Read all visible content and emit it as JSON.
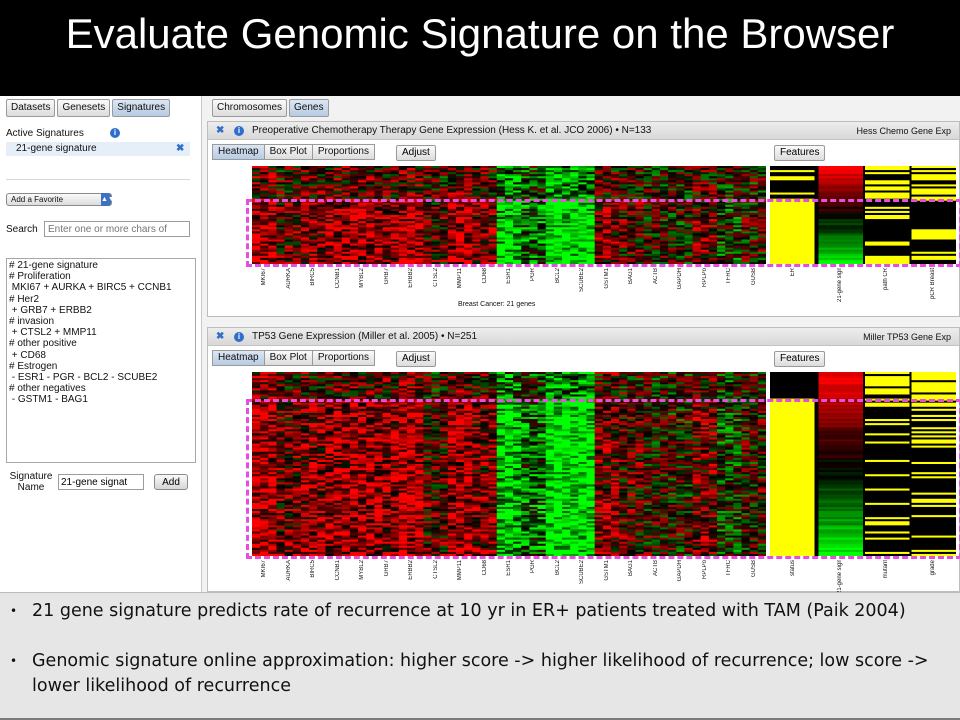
{
  "slide": {
    "title": "Evaluate Genomic Signature on the Browser"
  },
  "left_panel": {
    "tabs": [
      "Datasets",
      "Genesets",
      "Signatures"
    ],
    "active_tab": "Signatures",
    "active_signatures_label": "Active Signatures",
    "active_signature": "21-gene signature",
    "favorite_select_value": "Add a Favorite",
    "search_label": "Search",
    "search_placeholder": "Enter one or more chars of",
    "signature_text": "# 21-gene signature\n# Proliferation\n MKI67 + AURKA + BIRC5 + CCNB1\n# Her2\n + GRB7 + ERBB2\n# invasion\n + CTSL2 + MMP11\n# other positive\n + CD68\n# Estrogen\n - ESR1 - PGR - BCL2 - SCUBE2\n# other negatives\n - GSTM1 - BAG1",
    "signature_name_label": "Signature Name",
    "signature_name_value": "21-gene signat",
    "add_label": "Add"
  },
  "right_tabs": [
    "Chromosomes",
    "Genes"
  ],
  "right_active_tab": "Genes",
  "view_tabs": [
    "Heatmap",
    "Box Plot",
    "Proportions"
  ],
  "adjust_label": "Adjust",
  "features_label": "Features",
  "genes": [
    "MKI67",
    "AURKA",
    "BIRC5",
    "CCNB1",
    "MYBL2",
    "GRB7",
    "ERBB2",
    "CTSL2",
    "MMP11",
    "CD68",
    "ESR1",
    "PGR",
    "BCL2",
    "SCUBE2",
    "GSTM1",
    "BAG1",
    "ACTB",
    "GAPDH",
    "RPLPo",
    "TFRC",
    "GUSB"
  ],
  "panels": [
    {
      "title": "Preoperative Chemotherapy Therapy Gene Expression (Hess K. et al. JCO 2006) • N=133",
      "source": "Hess Chemo Gene Exp",
      "gene_caption": "Breast Cancer: 21 genes",
      "features": [
        "ER",
        "21-gene signature",
        "path CR",
        "pCR Breast"
      ]
    },
    {
      "title": "TP53 Gene Expression (Miller et al. 2005) • N=251",
      "source": "Miller TP53 Gene Exp",
      "features": [
        "status",
        "21-gene signature",
        "mutant",
        "grade"
      ]
    }
  ],
  "colors": {
    "heat_high": "#ff2a1a",
    "heat_low": "#33ff33",
    "feature_yellow": "#ffff00",
    "highlight_dash": "#e64ee0"
  },
  "bullets": [
    "21 gene signature predicts rate of recurrence at 10 yr in ER+ patients treated with TAM  (Paik 2004)",
    "Genomic signature online approximation: higher score -> higher likelihood of recurrence; low score -> lower likelihood of recurrence"
  ]
}
